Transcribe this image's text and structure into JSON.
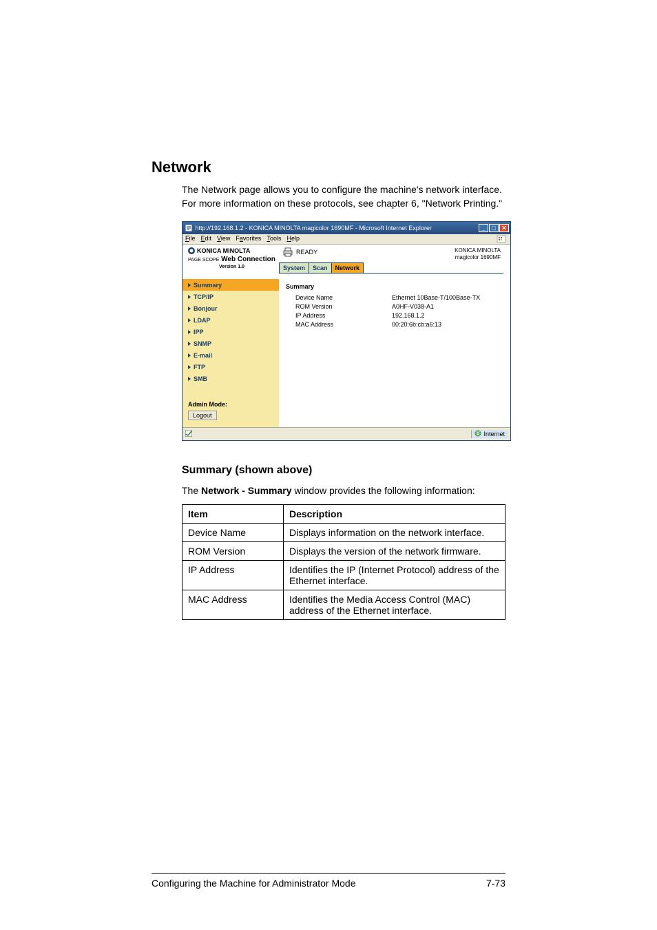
{
  "heading": "Network",
  "intro": "The Network page allows you to configure the machine's network interface. For more information on these protocols, see chapter 6, \"Network Printing.\"",
  "browser": {
    "title": "http://192.168.1.2 - KONICA MINOLTA magicolor 1690MF - Microsoft Internet Explorer",
    "menu": {
      "file": "File",
      "edit": "Edit",
      "view": "View",
      "favorites": "Favorites",
      "tools": "Tools",
      "help": "Help"
    },
    "logo_brand": "KONICA MINOLTA",
    "logo_product_prefix": "PAGE SCOPE",
    "logo_product": "Web Connection",
    "version": "Version 1.0",
    "ready": "READY",
    "device_brand": "KONICA MINOLTA",
    "device_model": "magicolor 1690MF",
    "tabs": {
      "system": "System",
      "scan": "Scan",
      "network": "Network"
    },
    "sidebar": {
      "summary": "Summary",
      "tcpip": "TCP/IP",
      "bonjour": "Bonjour",
      "ldap": "LDAP",
      "ipp": "IPP",
      "snmp": "SNMP",
      "email": "E-mail",
      "ftp": "FTP",
      "smb": "SMB"
    },
    "admin_label": "Admin Mode:",
    "logout": "Logout",
    "content": {
      "title": "Summary",
      "rows": {
        "device_name_k": "Device Name",
        "device_name_v": "Ethernet 10Base-T/100Base-TX",
        "rom_k": "ROM Version",
        "rom_v": "A0HF-V038-A1",
        "ip_k": "IP Address",
        "ip_v": "192.168.1.2",
        "mac_k": "MAC Address",
        "mac_v": "00:20:6b:cb:a6:13"
      }
    },
    "status_internet": "Internet"
  },
  "subheading": "Summary (shown above)",
  "desc_prefix": "The ",
  "desc_bold": "Network - Summary",
  "desc_suffix": " window provides the following information:",
  "table": {
    "headers": {
      "item": "Item",
      "desc": "Description"
    },
    "rows": [
      {
        "item": "Device Name",
        "desc": "Displays information on the network interface."
      },
      {
        "item": "ROM Version",
        "desc": "Displays the version of the network firmware."
      },
      {
        "item": "IP Address",
        "desc": "Identifies the IP (Internet Protocol) address of the Ethernet interface."
      },
      {
        "item": "MAC Address",
        "desc": "Identifies the Media Access Control (MAC) address of the Ethernet interface."
      }
    ]
  },
  "footer": {
    "text": "Configuring the Machine for Administrator Mode",
    "pagenum": "7-73"
  }
}
